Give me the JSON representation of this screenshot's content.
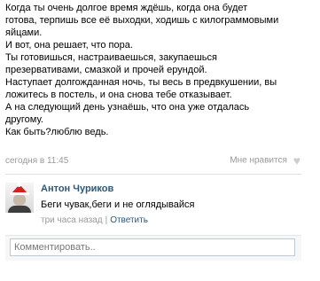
{
  "post": {
    "lines": [
      "Когда ты очень долгое время ждёшь, когда она будет",
      "готова, терпишь все её выходки, ходишь с килограммовыми",
      "яйцами.",
      "И вот, она решает, что пора.",
      "Ты готовишься, настраиваешься, закупаешься",
      "презервативами, смазкой и прочей ерундой.",
      "Наступает долгожданная ночь, ты весь в предвкушении, вы",
      "ложитесь в постель, и она снова тебе отказывает.",
      "А на следующий день узнаёшь, что она уже отдалась",
      "другому.",
      "Как быть?люблю ведь."
    ],
    "timestamp": "сегодня в 11:45",
    "like_label": "Мне нравится"
  },
  "comment": {
    "author": "Антон Чуриков",
    "text": "Беги чувак,беги и не оглядывайся",
    "time": "три часа назад",
    "separator": "|",
    "reply_label": "Ответить"
  },
  "reply_box": {
    "placeholder": "Комментировать.."
  },
  "colors": {
    "link": "#2b587a",
    "muted": "#999999",
    "divider": "#dae1e8"
  }
}
